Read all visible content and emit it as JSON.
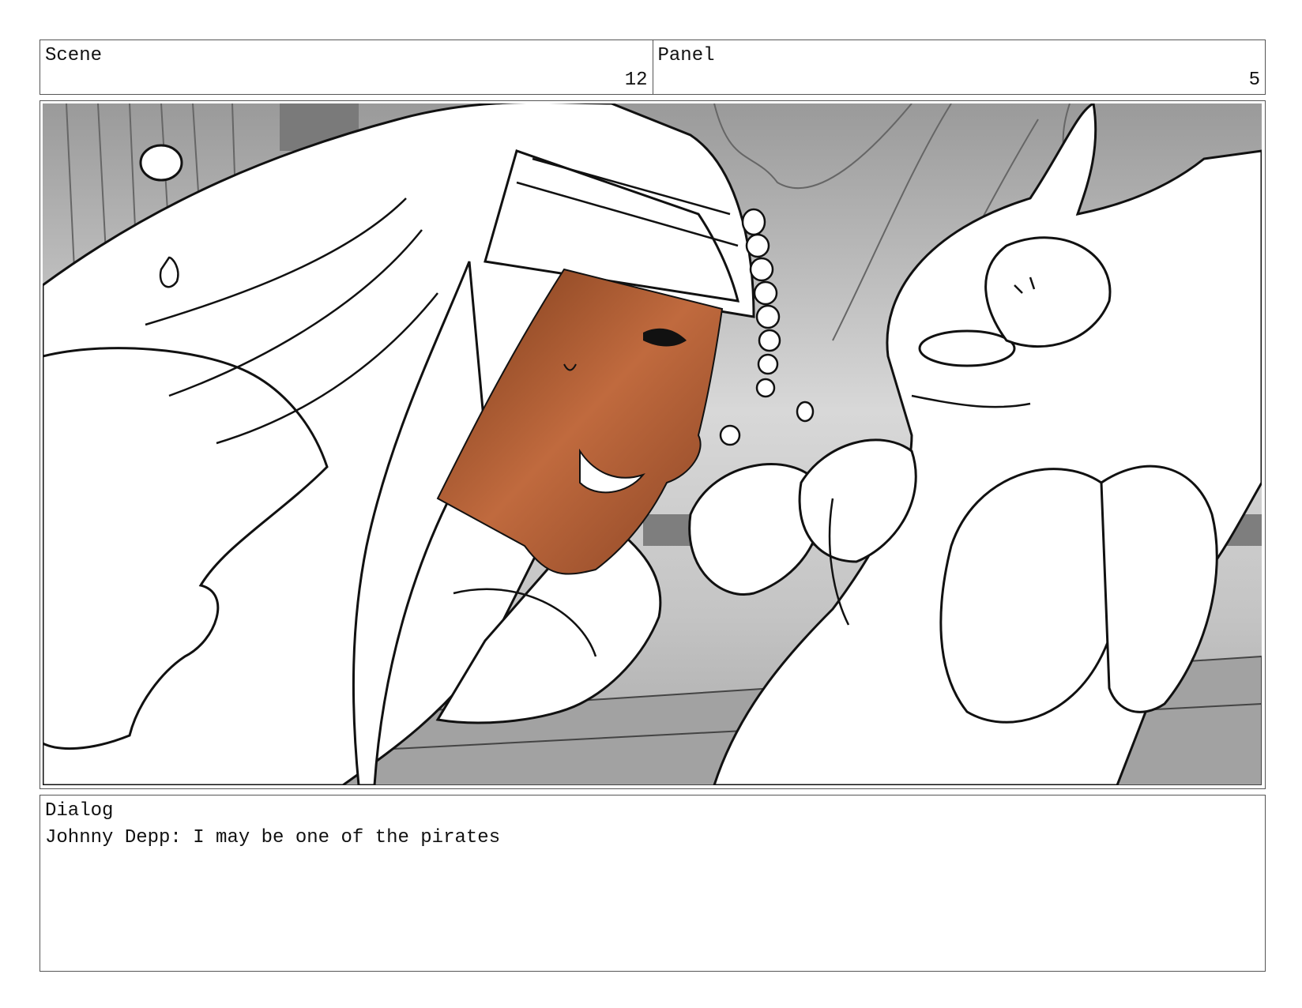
{
  "header": {
    "scene_label": "Scene",
    "scene_number": "12",
    "panel_label": "Panel",
    "panel_number": "5"
  },
  "artwork": {
    "description_icon": "storyboard-sketch-image"
  },
  "dialog": {
    "label": "Dialog",
    "text": "Johnny Depp: I may be one of the pirates"
  }
}
